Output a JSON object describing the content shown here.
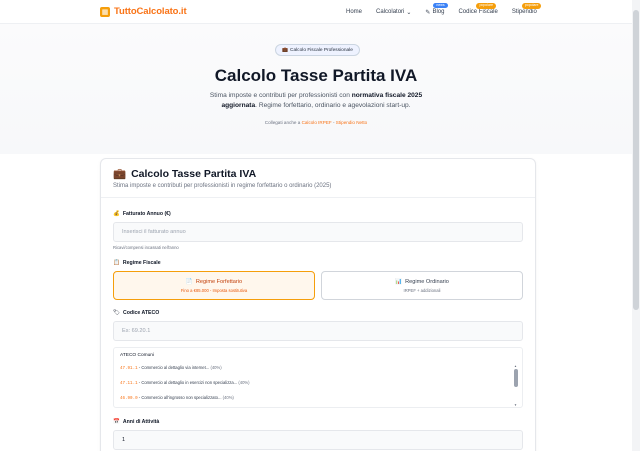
{
  "nav": {
    "logo_text": "TuttoCalcolato.it",
    "logo_icon": "calculator-icon",
    "links": [
      {
        "label": "Home",
        "badge": ""
      },
      {
        "label": "Calcolatori",
        "badge": "",
        "chevron": "⌄"
      },
      {
        "label": "Blog",
        "badge": "news",
        "icon": "pen-icon"
      },
      {
        "label": "Codice Fiscale",
        "badge": "popolare"
      },
      {
        "label": "Stipendio",
        "badge": "popolare"
      }
    ]
  },
  "hero": {
    "pill": "Calcolo Fiscale Professionale",
    "title": "Calcolo Tasse Partita IVA",
    "subtitle_pre": "Stima imposte e contributi per professionisti con ",
    "subtitle_bold": "normativa fiscale 2025 aggiornata",
    "subtitle_post": ". Regime forfettario, ordinario e agevolazioni start-up.",
    "related_prefix": "Collegati anche a ",
    "related_link_1": "Calcolo IRPEF",
    "related_sep": " - ",
    "related_link_2": "Stipendio Netto"
  },
  "card": {
    "title": "Calcolo Tasse Partita IVA",
    "subtitle": "Stima imposte e contributi per professionisti in regime forfettario o ordinario (2025)",
    "fatturato": {
      "label": "Fatturato Annuo (€)",
      "placeholder": "Inserisci il fatturato annuo",
      "hint": "Ricavi/compensi incassati nell'anno"
    },
    "regime": {
      "label": "Regime Fiscale",
      "options": [
        {
          "title": "Regime Forfettario",
          "desc": "Fino a €85.000 - Imposta sostitutiva",
          "selected": true
        },
        {
          "title": "Regime Ordinario",
          "desc": "IRPEF + addizionali",
          "selected": false
        }
      ]
    },
    "ateco": {
      "label": "Codice ATECO",
      "placeholder": "Es: 69.20.1",
      "list_title": "ATECO Comuni",
      "items": [
        {
          "code": "47.91.1",
          "text": " - Commercio al dettaglio via internet...",
          "pct": " (40%)"
        },
        {
          "code": "47.11.1",
          "text": " - Commercio al dettaglio in esercizi non specializza...",
          "pct": " (40%)"
        },
        {
          "code": "46.90.0",
          "text": " - Commercio all'ingrosso non specializzato...",
          "pct": " (40%)"
        }
      ]
    },
    "anni": {
      "label": "Anni di Attività",
      "value": "1"
    }
  }
}
